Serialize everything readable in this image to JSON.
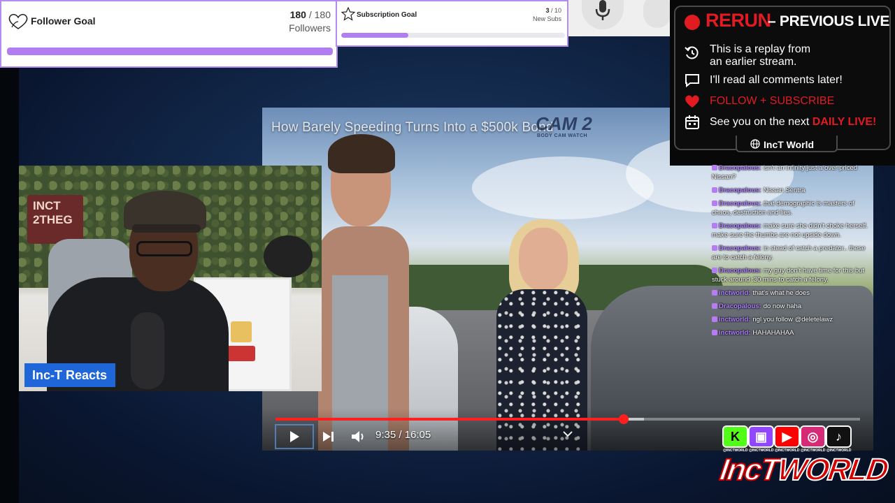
{
  "follower_goal": {
    "title": "Follower Goal",
    "current": "180",
    "separator": "/ 180",
    "unit": "Followers",
    "progress": 1.0,
    "icon": "heart-outline-icon",
    "bar_color": "#b07ef0"
  },
  "subscription_goal": {
    "title": "Subscription Goal",
    "current": "3",
    "separator": "/ 10",
    "unit": "New Subs",
    "progress": 0.3,
    "icon": "star-outline-icon",
    "bar_color": "#b07ef0"
  },
  "video": {
    "title": "How Barely Speeding Turns Into a $500k Bond",
    "cam_label": "CAM 2",
    "cam_sub": "BODY CAM WATCH",
    "time": "9:35 / 16:05",
    "progress": 0.596,
    "buffered": 0.63,
    "progress_color": "#ff1f1f",
    "icons": [
      "play-icon",
      "next-icon",
      "volume-icon",
      "chevron-down-icon",
      "mic-icon"
    ]
  },
  "webcam": {
    "label": "Inc-T Reacts",
    "sign_text": "INCT\n2THEG",
    "badge_color": "#1f67d8"
  },
  "rerun": {
    "title_red": "RERUN",
    "title_white": "– PREVIOUS LIVE",
    "line1a": "This is a replay from",
    "line1b": "an earlier stream.",
    "line2": "I'll read all comments later!",
    "line3": "FOLLOW + SUBSCRIBE",
    "line4_white": "See you on the next",
    "line4_red": "DAILY LIVE!",
    "footer": "IncT World",
    "accent": "#e21b23",
    "icons": [
      "replay-icon",
      "comment-icon",
      "heart-icon",
      "calendar-icon",
      "globe-icon"
    ]
  },
  "chat": {
    "messages": [
      {
        "user": "Dracopalous:",
        "text": "isn't an infinity just a over priced Nissan?"
      },
      {
        "user": "Dracopalous:",
        "text": "Nissan Sentra"
      },
      {
        "user": "Dracopalous:",
        "text": "that demographic is masters of chaos, destruction and lies."
      },
      {
        "user": "Dracopalous:",
        "text": "make sure she didn't choke herself. make sure the thumbs are not upside down."
      },
      {
        "user": "Dracopalous:",
        "text": "in stead of catch a predator.. these are to catch a felony."
      },
      {
        "user": "Dracopalous:",
        "text": "my guy don't have time for this but stuck around :30 mins to catch a felony."
      },
      {
        "user": "inctworld:",
        "text": "that's what he does"
      },
      {
        "user": "Dracopalous:",
        "text": "do now haha"
      },
      {
        "user": "inctworld:",
        "text": "ngl you follow @deletelawz"
      },
      {
        "user": "inctworld:",
        "text": "HAHAHAHAA"
      }
    ]
  },
  "socials": {
    "items": [
      {
        "name": "kick-icon",
        "label": "@INCTWORLD",
        "color": "#53fc18"
      },
      {
        "name": "twitch-icon",
        "label": "@INCTWORLD",
        "color": "#9146ff"
      },
      {
        "name": "youtube-icon",
        "label": "@INCTWORLD",
        "color": "#ff0000"
      },
      {
        "name": "instagram-icon",
        "label": "@INCTWORLD",
        "color": "#d62976"
      },
      {
        "name": "tiktok-icon",
        "label": "@INCTWORLD",
        "color": "#111111"
      }
    ],
    "logo_a": "IncT",
    "logo_b": "WORLD"
  }
}
